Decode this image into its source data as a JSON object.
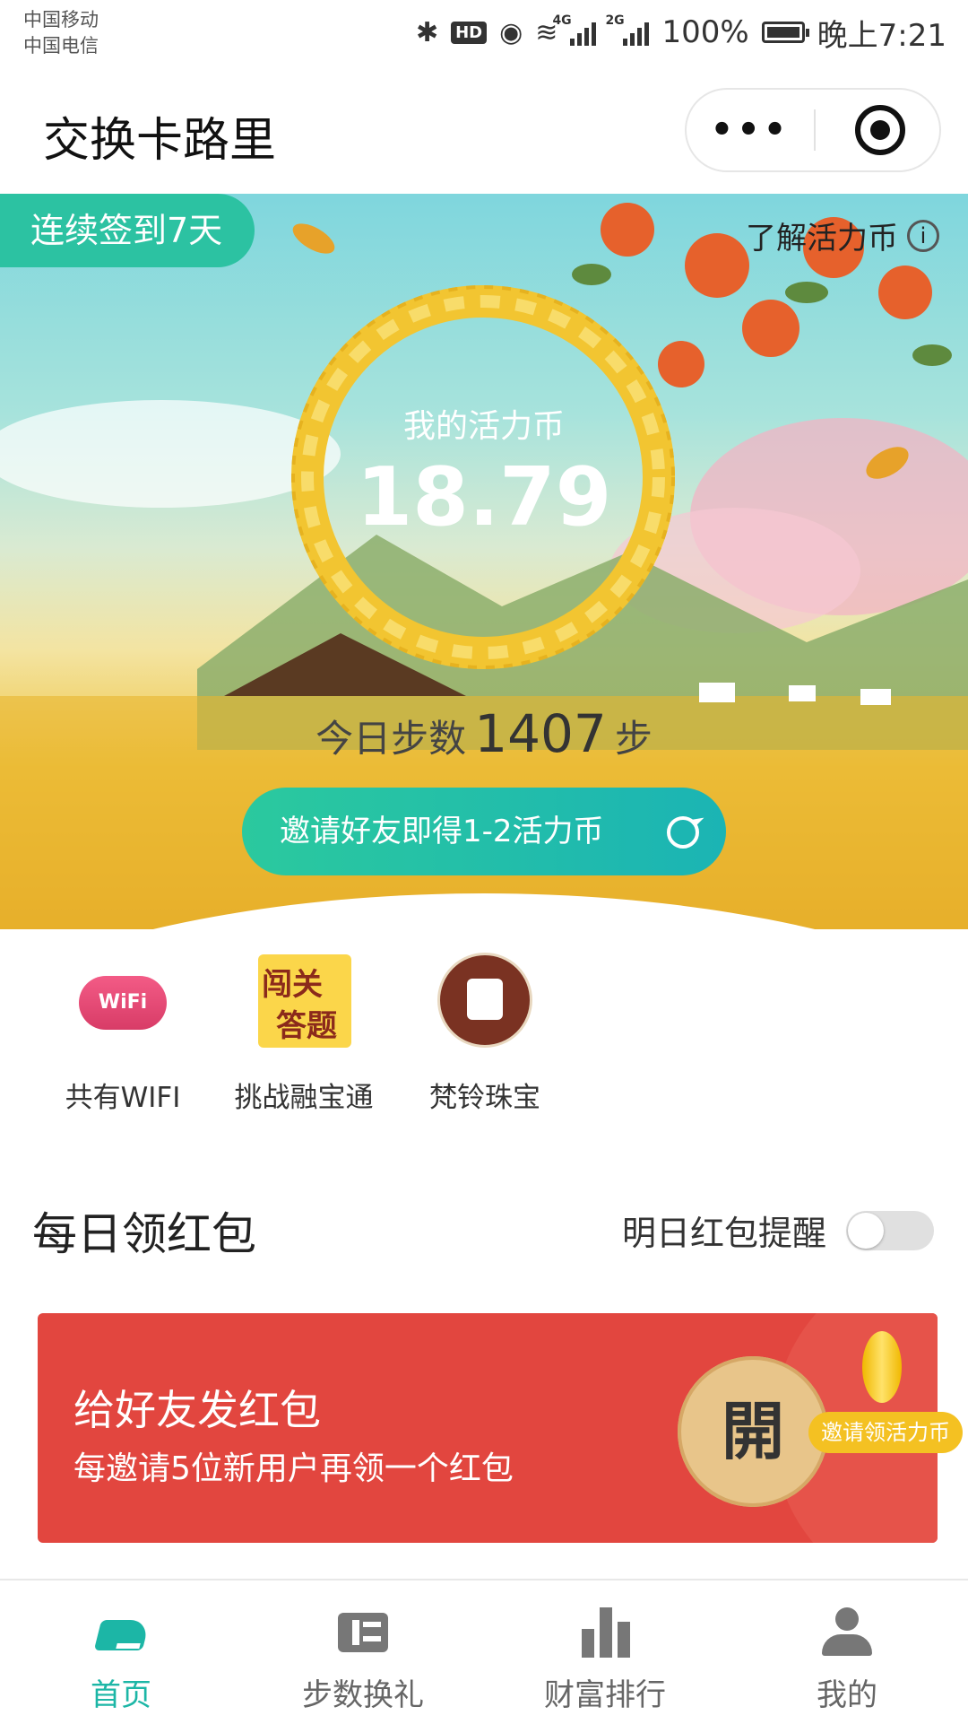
{
  "status_bar": {
    "carrier1": "中国移动",
    "carrier2": "中国电信",
    "hd_label": "HD",
    "net1": "4G",
    "net2": "2G",
    "battery": "100%",
    "time": "晚上7:21",
    "icons": [
      "bluetooth-icon",
      "hd-icon",
      "eye-icon",
      "wifi-icon",
      "signal-icon",
      "signal-icon",
      "battery-icon"
    ]
  },
  "header": {
    "title": "交换卡路里",
    "more_label": "•••"
  },
  "hero": {
    "streak_badge": "连续签到7天",
    "about_link": "了解活力币",
    "info_glyph": "i",
    "coin_label": "我的活力币",
    "coin_value": "18.79",
    "steps_label": "今日步数",
    "steps_value": "1407",
    "steps_unit": "步",
    "invite_button": "邀请好友即得1-2活力币",
    "colors": {
      "accent": "#2cc2a2",
      "wreath": "#f2c531"
    }
  },
  "shortcuts": [
    {
      "label": "共有WIFI",
      "icon_text": "WiFi",
      "icon": "wifi-cloud-icon"
    },
    {
      "label": "挑战融宝通",
      "icon_text_1": "闯关",
      "icon_text_2": "答题",
      "icon": "quiz-icon"
    },
    {
      "label": "梵铃珠宝",
      "icon": "jewelry-logo-icon"
    }
  ],
  "daily": {
    "title": "每日领红包",
    "remind_label": "明日红包提醒",
    "remind_on": false
  },
  "packet": {
    "title": "给好友发红包",
    "subtitle": "每邀请5位新用户再领一个红包",
    "open_label": "開",
    "invite_pill": "邀请领活力币",
    "colors": {
      "bg": "#e2463f",
      "button": "#e8c58a"
    }
  },
  "tabs": [
    {
      "label": "首页",
      "icon": "shoe-icon",
      "active": true
    },
    {
      "label": "步数换礼",
      "icon": "ticket-icon",
      "active": false
    },
    {
      "label": "财富排行",
      "icon": "bar-chart-icon",
      "active": false
    },
    {
      "label": "我的",
      "icon": "person-icon",
      "active": false
    }
  ]
}
